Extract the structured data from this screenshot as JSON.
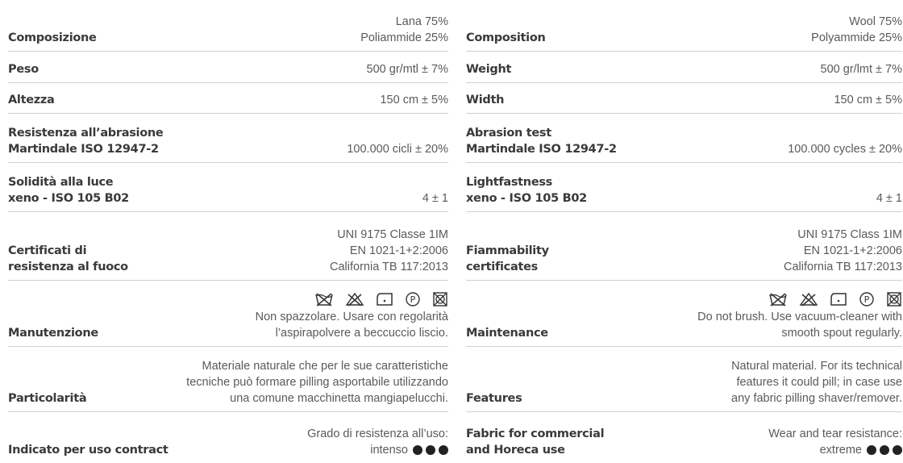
{
  "it": {
    "composition": {
      "label": "Composizione",
      "lines": [
        "Lana 75%",
        "Poliammide 25%"
      ]
    },
    "weight": {
      "label": "Peso",
      "value": "500 gr/mtl ± 7%"
    },
    "width": {
      "label": "Altezza",
      "value": "150 cm ± 5%"
    },
    "abrasion": {
      "label_lines": [
        "Resistenza all’abrasione",
        "Martindale ISO 12947-2"
      ],
      "value": "100.000 cicli ± 20%"
    },
    "light": {
      "label_lines": [
        "Solidità alla luce",
        "xeno - ISO 105 B02"
      ],
      "value": "4 ± 1"
    },
    "fire": {
      "label_lines": [
        "Certificati di",
        "resistenza al fuoco"
      ],
      "lines": [
        "UNI 9175 Classe 1IM",
        "EN 1021-1+2:2006",
        "California TB 117:2013"
      ]
    },
    "care": {
      "label": "Manutenzione",
      "lines": [
        "Non spazzolare. Usare con regolarità",
        "l’aspirapolvere a beccuccio liscio."
      ]
    },
    "features": {
      "label": "Particolarità",
      "lines": [
        "Materiale naturale che per le sue caratteristiche",
        "tecniche può formare pilling asportabile utilizzando",
        "una comune macchinetta mangiapelucchi."
      ]
    },
    "use": {
      "label_lines": [
        "Indicato per uso contract"
      ],
      "lines": [
        "Grado di resistenza all’uso:",
        "intenso"
      ]
    }
  },
  "en": {
    "composition": {
      "label": "Composition",
      "lines": [
        "Wool 75%",
        "Polyammide 25%"
      ]
    },
    "weight": {
      "label": "Weight",
      "value": "500 gr/lmt ± 7%"
    },
    "width": {
      "label": "Width",
      "value": "150 cm ± 5%"
    },
    "abrasion": {
      "label_lines": [
        "Abrasion test",
        "Martindale ISO 12947-2"
      ],
      "value": "100.000 cycles ± 20%"
    },
    "light": {
      "label_lines": [
        "Lightfastness",
        "xeno - ISO 105 B02"
      ],
      "value": "4 ± 1"
    },
    "fire": {
      "label_lines": [
        "Fiammability",
        "certificates"
      ],
      "lines": [
        "UNI 9175 Class 1IM",
        "EN 1021-1+2:2006",
        "California TB 117:2013"
      ]
    },
    "care": {
      "label": "Maintenance",
      "lines": [
        "Do not brush. Use vacuum-cleaner with",
        "smooth spout regularly."
      ]
    },
    "features": {
      "label": "Features",
      "lines": [
        "Natural material. For its technical",
        "features it could pill; in case use",
        "any fabric pilling shaver/remover."
      ]
    },
    "use": {
      "label_lines": [
        "Fabric for commercial",
        "and Horeca use"
      ],
      "lines": [
        "Wear and tear resistance:",
        "extreme"
      ]
    }
  },
  "care_icons": [
    "do-not-wash-icon",
    "do-not-bleach-icon",
    "do-not-tumble-dry-icon",
    "dry-clean-p-icon",
    "do-not-wet-clean-icon"
  ],
  "resistance_level": {
    "filled_dots": 3,
    "total_dots": 3
  }
}
